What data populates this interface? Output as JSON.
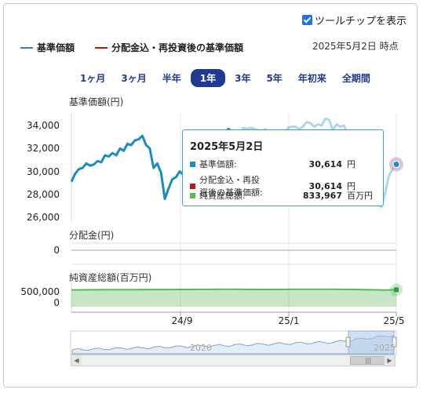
{
  "toolbar": {
    "tooltip_toggle_label": "ツールチップを表示",
    "tooltip_toggle_checked": true
  },
  "legend": [
    {
      "label": "基準価額",
      "color": "#1a8cbf"
    },
    {
      "label": "分配金込・再投資後の基準価額",
      "color": "#c0141e"
    }
  ],
  "as_of": "2025年5月2日 時点",
  "ranges": [
    {
      "label": "1ヶ月",
      "active": false
    },
    {
      "label": "3ヶ月",
      "active": false
    },
    {
      "label": "半年",
      "active": false
    },
    {
      "label": "1年",
      "active": true
    },
    {
      "label": "3年",
      "active": false
    },
    {
      "label": "5年",
      "active": false
    },
    {
      "label": "年初来",
      "active": false
    },
    {
      "label": "全期間",
      "active": false
    }
  ],
  "panels": {
    "nav_title": "基準価額(円)",
    "dist_title": "分配金(円)",
    "assets_title": "純資産総額(百万円)"
  },
  "tooltip": {
    "date": "2025年5月2日",
    "rows": [
      {
        "label": "基準価額:",
        "value": "30,614",
        "unit": "円",
        "color": "#1a8cbf"
      },
      {
        "label": "分配金込・再投資後の基準価額:",
        "value": "30,614",
        "unit": "円",
        "color": "#c0141e"
      },
      {
        "label": "純資産総額:",
        "value": "833,967",
        "unit": "百万円",
        "color": "#5cb85c"
      }
    ]
  },
  "navigator": {
    "labels": [
      "2020",
      "2025"
    ]
  },
  "chart_data": [
    {
      "type": "line",
      "title": "基準価額(円)",
      "ylim": [
        26000,
        35000
      ],
      "yticks": [
        "34,000",
        "32,000",
        "30,000",
        "28,000",
        "26,000"
      ],
      "ytick_values": [
        34000,
        32000,
        30000,
        28000,
        26000
      ],
      "xticks": [
        "24/9",
        "25/1",
        "25/5"
      ],
      "series": [
        {
          "name": "基準価額",
          "color": "#1a8cbf",
          "values": [
            29100,
            29800,
            30200,
            30300,
            30700,
            30500,
            30600,
            30900,
            30800,
            31400,
            31300,
            31600,
            31400,
            32000,
            31800,
            32400,
            32300,
            32700,
            32800,
            33100,
            32300,
            32000,
            30300,
            30700,
            29900,
            27600,
            28500,
            29300,
            29500,
            30000,
            29700,
            31200,
            31700,
            30500,
            32500,
            32800,
            32300,
            33500,
            33000,
            33200,
            32600,
            33300,
            33700,
            33500,
            33400,
            33000,
            33800,
            33700,
            33800,
            33700,
            33600,
            33500,
            33700,
            32400,
            33000,
            33300,
            33500,
            33100,
            33800,
            33900,
            33900,
            33700,
            33900,
            34300,
            34200,
            33900,
            34100,
            34000,
            34600,
            34500,
            33600,
            34100,
            33900,
            34000,
            33200,
            33400,
            33500,
            33200,
            32200,
            31500,
            30000,
            30200,
            27200,
            26900,
            28100,
            29600,
            30200,
            30614
          ],
          "dim_from_index": 45
        }
      ],
      "dist_value": 0,
      "dist_ytick": "0",
      "assets_yticks": [
        "500,000",
        "0"
      ],
      "assets_values": [
        820000,
        825000,
        830000,
        835000,
        838000,
        840000,
        842000,
        845000,
        843000,
        846000,
        850000,
        852000,
        855000,
        853000,
        858000,
        860000,
        855000,
        850000,
        848000,
        852000,
        855000,
        858000,
        860000,
        862000,
        858000,
        855000,
        850000,
        840000,
        825000,
        815000,
        833967
      ],
      "assets_color": "#5cb85c"
    }
  ]
}
